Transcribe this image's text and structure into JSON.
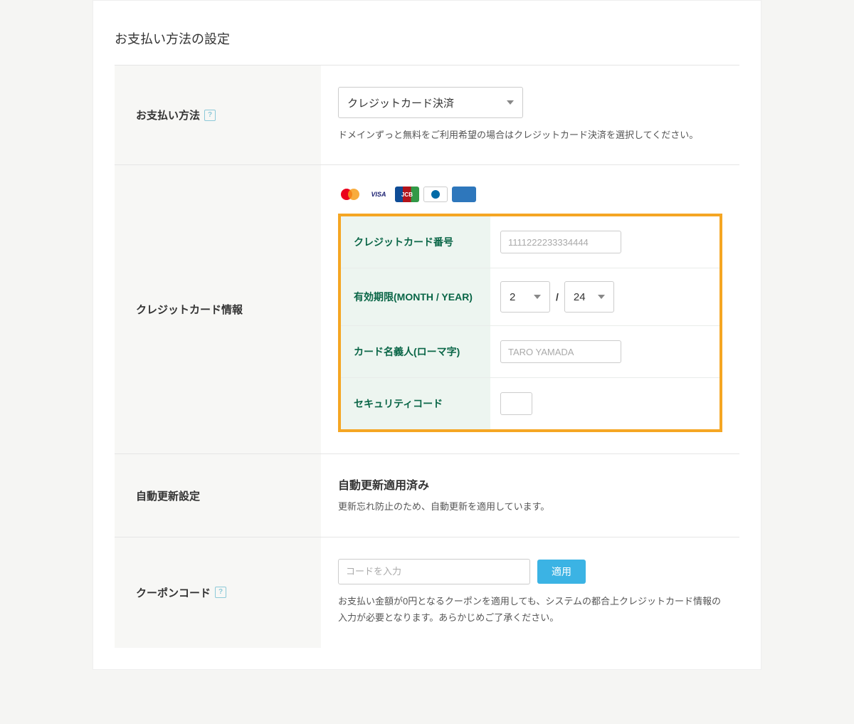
{
  "title": "お支払い方法の設定",
  "payment_method": {
    "label": "お支払い方法",
    "selected": "クレジットカード決済",
    "note": "ドメインずっと無料をご利用希望の場合はクレジットカード決済を選択してください。"
  },
  "cc_info": {
    "section_label": "クレジットカード情報",
    "brands": {
      "visa": "VISA",
      "jcb": "JCB",
      "diners": "Diners Club",
      "amex": "AMERICAN EXPRESS"
    },
    "fields": {
      "number_label": "クレジットカード番号",
      "number_placeholder": "1111222233334444",
      "expiry_label": "有効期限(MONTH / YEAR)",
      "expiry_month": "2",
      "expiry_year": "24",
      "expiry_sep": "/",
      "name_label": "カード名義人(ローマ字)",
      "name_placeholder": "TARO YAMADA",
      "cvv_label": "セキュリティコード"
    }
  },
  "auto_renew": {
    "label": "自動更新設定",
    "status": "自動更新適用済み",
    "note": "更新忘れ防止のため、自動更新を適用しています。"
  },
  "coupon": {
    "label": "クーポンコード",
    "placeholder": "コードを入力",
    "apply": "適用",
    "note": "お支払い金額が0円となるクーポンを適用しても、システムの都合上クレジットカード情報の入力が必要となります。あらかじめご了承ください。"
  },
  "help": "?"
}
